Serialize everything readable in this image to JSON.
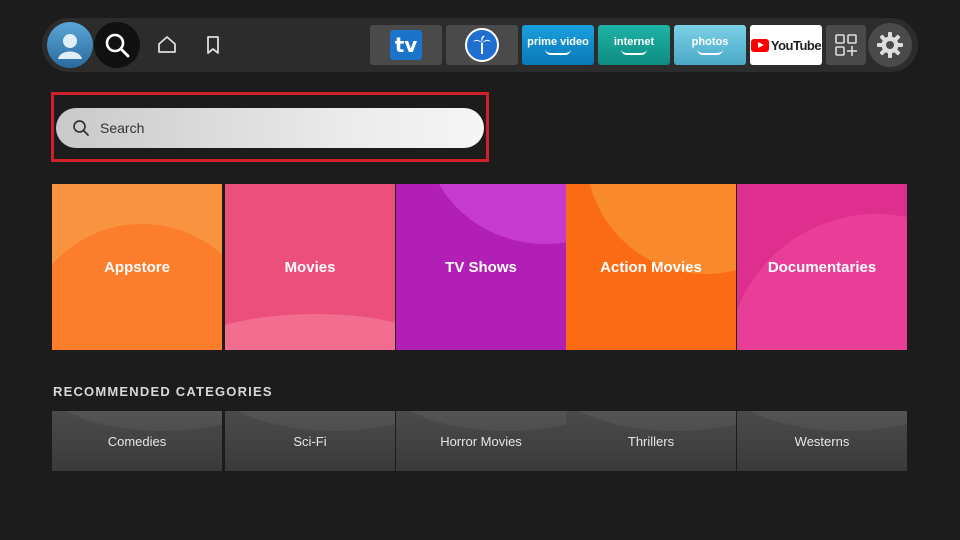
{
  "nav": {
    "apps": {
      "prime_video": "prime video",
      "internet": "internet",
      "photos": "photos",
      "youtube": "YouTube",
      "tv": "tv"
    }
  },
  "search": {
    "placeholder": "Search"
  },
  "categories": [
    "Appstore",
    "Movies",
    "TV Shows",
    "Action Movies",
    "Documentaries"
  ],
  "recommended": {
    "heading": "RECOMMENDED CATEGORIES",
    "items": [
      "Comedies",
      "Sci-Fi",
      "Horror Movies",
      "Thrillers",
      "Westerns"
    ]
  },
  "colors": {
    "highlight": "#d0202a",
    "background": "#1c1c1c"
  }
}
